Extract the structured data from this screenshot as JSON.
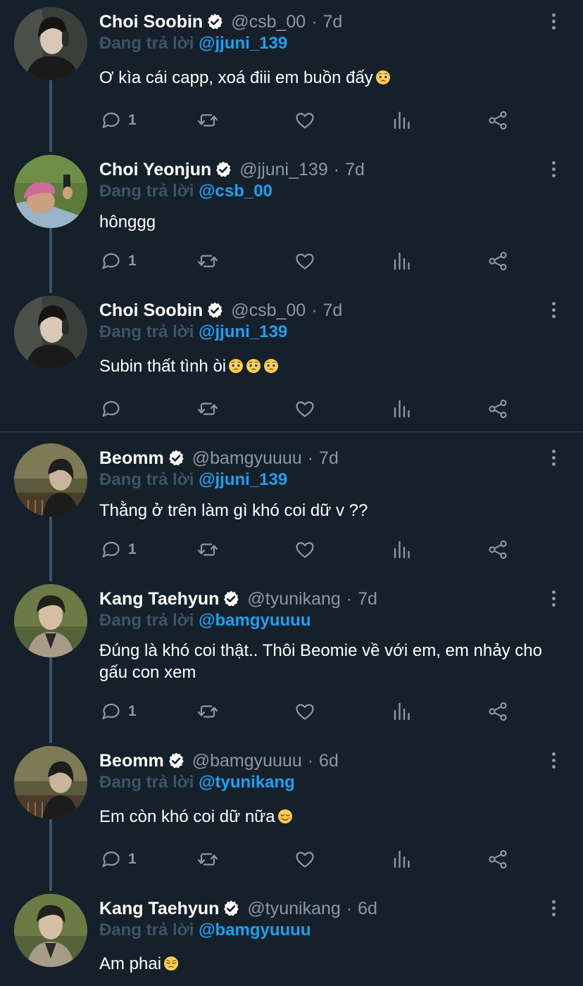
{
  "reply_prefix": "Đang trả lời",
  "colors": {
    "background": "#15202b",
    "text_primary": "#ffffff",
    "text_secondary": "#8899a6",
    "mention": "#1da1f2",
    "thread_line": "#3d5466",
    "divider": "#38444d"
  },
  "tweets": [
    {
      "name": "Choi Soobin",
      "handle": "@csb_00",
      "separator": "·",
      "time": "7d",
      "verified": true,
      "reply_to": "@jjuni_139",
      "text": "Ơ kìa cái capp, xoá điii em buồn đấy",
      "emojis": [
        "pleading-face-emoji"
      ],
      "reply_count": "1",
      "avatar": "person-dark-hair-headphones"
    },
    {
      "name": "Choi Yeonjun",
      "handle": "@jjuni_139",
      "separator": "·",
      "time": "7d",
      "verified": true,
      "reply_to": "@csb_00",
      "text": "hônggg",
      "emojis": [],
      "reply_count": "1",
      "avatar": "person-pink-cap-grass"
    },
    {
      "name": "Choi Soobin",
      "handle": "@csb_00",
      "separator": "·",
      "time": "7d",
      "verified": true,
      "reply_to": "@jjuni_139",
      "text": "Subin thất tình òi",
      "emojis": [
        "pleading-face-emoji",
        "pleading-face-emoji",
        "pleading-face-emoji"
      ],
      "reply_count": "",
      "avatar": "person-dark-hair-headphones"
    },
    {
      "name": "Beomm",
      "handle": "@bamgyuuuu",
      "separator": "·",
      "time": "7d",
      "verified": true,
      "reply_to": "@jjuni_139",
      "text": "Thằng ở trên làm gì khó coi dữ v ??",
      "emojis": [],
      "reply_count": "1",
      "avatar": "person-dark-park"
    },
    {
      "name": "Kang Taehyun",
      "handle": "@tyunikang",
      "separator": "·",
      "time": "7d",
      "verified": true,
      "reply_to": "@bamgyuuuu",
      "text": "Đúng là khó coi thật.. Thôi Beomie về với em, em nhảy cho gấu con xem",
      "emojis": [],
      "reply_count": "1",
      "avatar": "person-green-backdrop"
    },
    {
      "name": "Beomm",
      "handle": "@bamgyuuuu",
      "separator": "·",
      "time": "6d",
      "verified": true,
      "reply_to": "@tyunikang",
      "text": "Em còn khó coi dữ nữa",
      "emojis": [
        "smiling-face-emoji"
      ],
      "reply_count": "1",
      "avatar": "person-dark-park"
    },
    {
      "name": "Kang Taehyun",
      "handle": "@tyunikang",
      "separator": "·",
      "time": "6d",
      "verified": true,
      "reply_to": "@bamgyuuuu",
      "text": "Am phai",
      "emojis": [
        "pensive-face-emoji"
      ],
      "reply_count": "",
      "avatar": "person-green-backdrop"
    }
  ]
}
